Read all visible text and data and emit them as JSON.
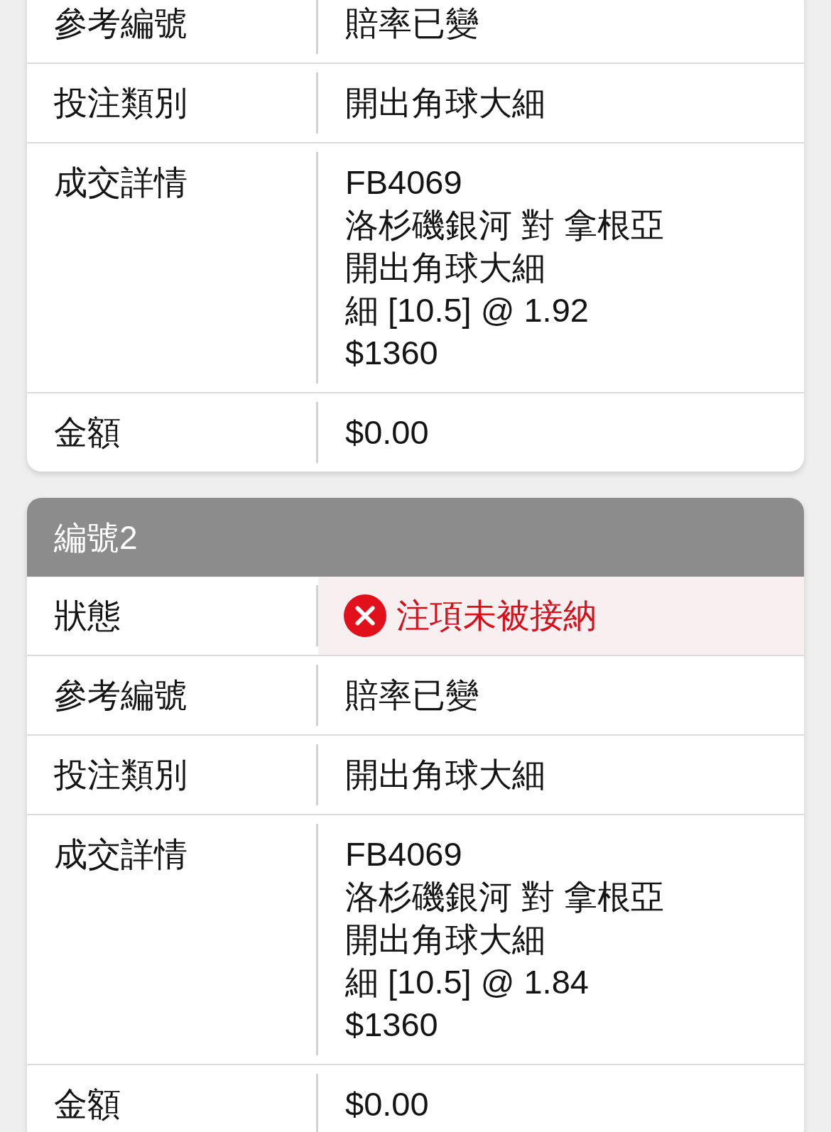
{
  "cards": [
    {
      "rows": [
        {
          "kind": "text",
          "label": "參考編號",
          "value": "賠率已變"
        },
        {
          "kind": "text",
          "label": "投注類別",
          "value": "開出角球大細"
        },
        {
          "kind": "lines",
          "label": "成交詳情",
          "lines": [
            "FB4069",
            "洛杉磯銀河 對 拿根亞",
            "開出角球大細",
            "細 [10.5] @ 1.92",
            "$1360"
          ]
        },
        {
          "kind": "text",
          "label": "金額",
          "value": "$0.00"
        }
      ]
    },
    {
      "title": "編號2",
      "rows": [
        {
          "kind": "status",
          "label": "狀態",
          "value": "注項未被接納",
          "accepted": false
        },
        {
          "kind": "text",
          "label": "參考編號",
          "value": "賠率已變"
        },
        {
          "kind": "text",
          "label": "投注類別",
          "value": "開出角球大細"
        },
        {
          "kind": "lines",
          "label": "成交詳情",
          "lines": [
            "FB4069",
            "洛杉磯銀河 對 拿根亞",
            "開出角球大細",
            "細 [10.5] @ 1.84",
            "$1360"
          ]
        },
        {
          "kind": "text",
          "label": "金額",
          "value": "$0.00"
        }
      ]
    }
  ]
}
